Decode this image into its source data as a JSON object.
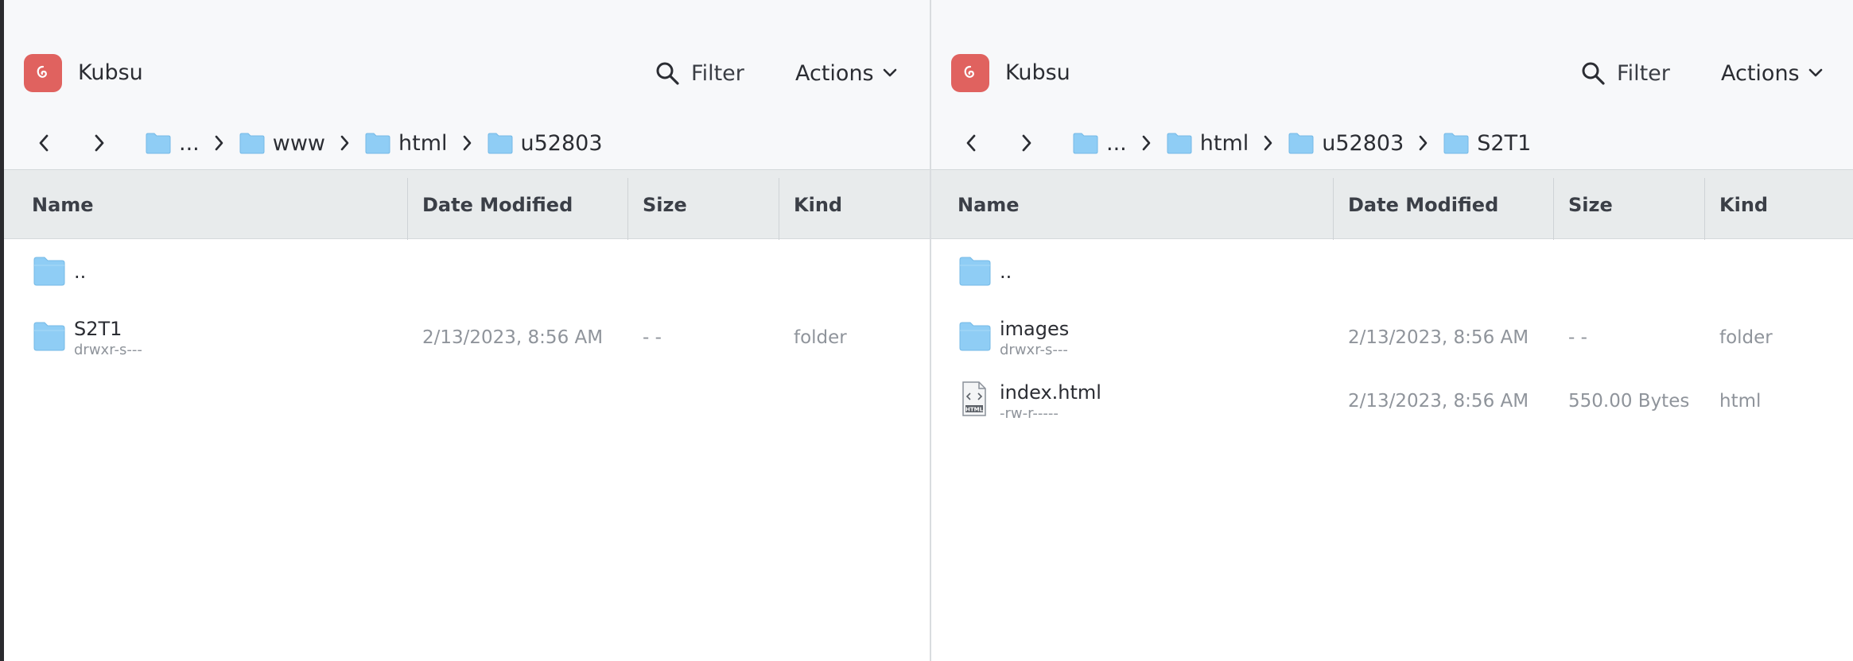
{
  "panes": [
    {
      "app_name": "Kubsu",
      "filter_label": "Filter",
      "actions_label": "Actions",
      "breadcrumb": [
        "...",
        "www",
        "html",
        "u52803"
      ],
      "columns": [
        "Name",
        "Date Modified",
        "Size",
        "Kind"
      ],
      "rows": [
        {
          "name": "..",
          "perm": "",
          "date": "",
          "size": "",
          "kind": "",
          "icon": "folder-icon"
        },
        {
          "name": "S2T1",
          "perm": "drwxr-s---",
          "date": "2/13/2023, 8:56 AM",
          "size": "- -",
          "kind": "folder",
          "icon": "folder-icon"
        }
      ]
    },
    {
      "app_name": "Kubsu",
      "filter_label": "Filter",
      "actions_label": "Actions",
      "breadcrumb": [
        "...",
        "html",
        "u52803",
        "S2T1"
      ],
      "columns": [
        "Name",
        "Date Modified",
        "Size",
        "Kind"
      ],
      "rows": [
        {
          "name": "..",
          "perm": "",
          "date": "",
          "size": "",
          "kind": "",
          "icon": "folder-icon"
        },
        {
          "name": "images",
          "perm": "drwxr-s---",
          "date": "2/13/2023, 8:56 AM",
          "size": "- -",
          "kind": "folder",
          "icon": "folder-icon"
        },
        {
          "name": "index.html",
          "perm": "-rw-r-----",
          "date": "2/13/2023, 8:56 AM",
          "size": "550.00 Bytes",
          "kind": "html",
          "icon": "html-file-icon"
        }
      ]
    }
  ],
  "colors": {
    "logo": "#e0625f",
    "folder": "#8fcdf5",
    "header_bg": "#f7f8fa",
    "column_header_bg": "#e8ebec"
  }
}
